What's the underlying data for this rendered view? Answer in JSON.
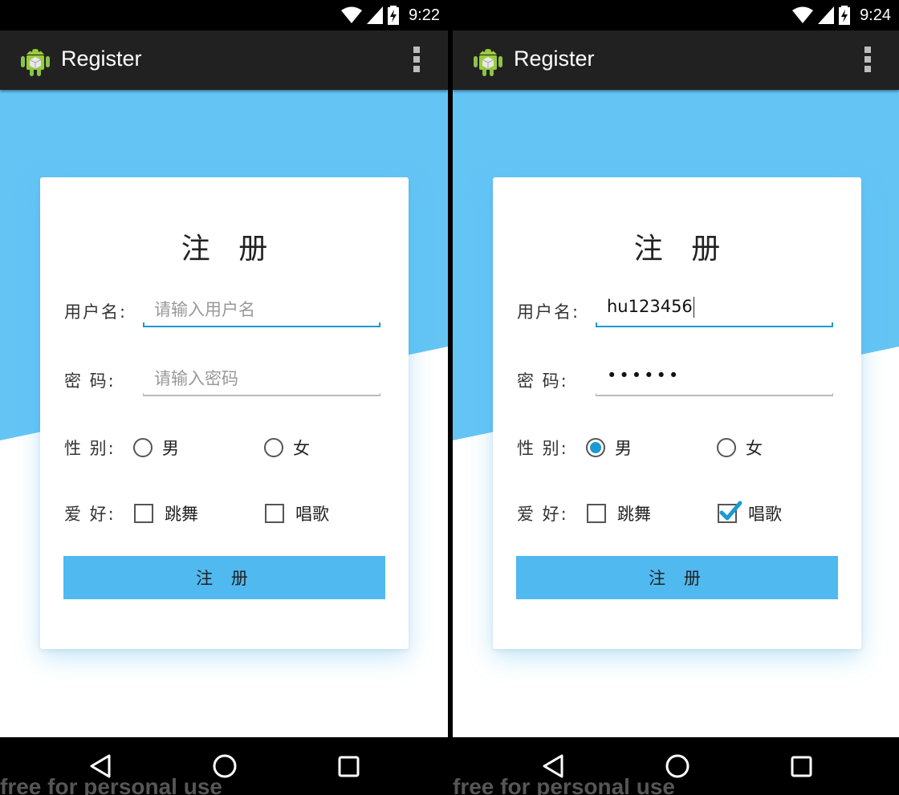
{
  "theme": {
    "accent": "#4fb9f0",
    "focus": "#1b9ad2",
    "appbar": "#212121"
  },
  "screens": [
    {
      "status": {
        "time": "9:22"
      },
      "appbar": {
        "title": "Register",
        "icon": "android-robot-icon",
        "menu_icon": "overflow-menu-icon"
      },
      "form": {
        "title": "注 册",
        "username": {
          "label": "用户名:",
          "placeholder": "请输入用户名",
          "value": ""
        },
        "password": {
          "label": "密 码:",
          "placeholder": "请输入密码",
          "value": ""
        },
        "gender": {
          "label": "性 别:",
          "options": [
            "男",
            "女"
          ],
          "selected": null
        },
        "hobby": {
          "label": "爱 好:",
          "options": [
            "跳舞",
            "唱歌"
          ],
          "checked": []
        },
        "submit_label": "注 册"
      },
      "watermark": "free for personal use"
    },
    {
      "status": {
        "time": "9:24"
      },
      "appbar": {
        "title": "Register",
        "icon": "android-robot-icon",
        "menu_icon": "overflow-menu-icon"
      },
      "form": {
        "title": "注 册",
        "username": {
          "label": "用户名:",
          "placeholder": "请输入用户名",
          "value": "hu123456"
        },
        "password": {
          "label": "密 码:",
          "placeholder": "请输入密码",
          "value": "••••••"
        },
        "gender": {
          "label": "性 别:",
          "options": [
            "男",
            "女"
          ],
          "selected": "男"
        },
        "hobby": {
          "label": "爱 好:",
          "options": [
            "跳舞",
            "唱歌"
          ],
          "checked": [
            "唱歌"
          ]
        },
        "submit_label": "注 册"
      },
      "watermark": "free for personal use"
    }
  ]
}
